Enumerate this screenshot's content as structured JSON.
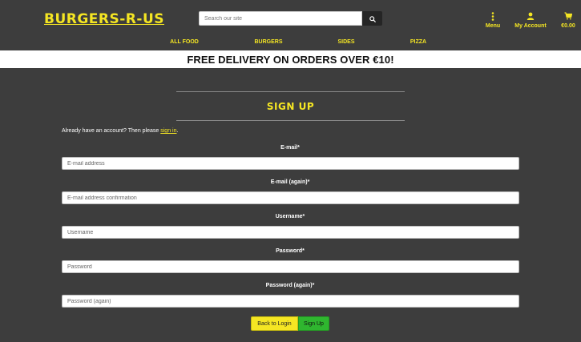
{
  "header": {
    "logo": "BURGERS-R-US",
    "search": {
      "placeholder": "Search our site",
      "value": ""
    },
    "links": {
      "menu": "Menu",
      "account": "My Account",
      "cart": "€0.00"
    },
    "nav": [
      "ALL FOOD",
      "BURGERS",
      "SIDES",
      "PIZZA"
    ]
  },
  "banner": "FREE DELIVERY ON ORDERS OVER €10!",
  "signup": {
    "title": "SIGN UP",
    "already_prefix": "Already have an account? Then please ",
    "already_link": "sign in",
    "already_suffix": ".",
    "fields": [
      {
        "label": "E-mail*",
        "placeholder": "E-mail address"
      },
      {
        "label": "E-mail (again)*",
        "placeholder": "E-mail address confirmation"
      },
      {
        "label": "Username*",
        "placeholder": "Username"
      },
      {
        "label": "Password*",
        "placeholder": "Password"
      },
      {
        "label": "Password (again)*",
        "placeholder": "Password (again)"
      }
    ],
    "back_button": "Back to Login",
    "submit_button": "Sign Up"
  },
  "colors": {
    "background": "#3d3d3d",
    "accent": "#f5e623",
    "banner_bg": "#ffffff",
    "signup_green": "#2fb62f"
  },
  "icons": [
    "search-icon",
    "ellipsis-vertical-icon",
    "user-icon",
    "shopping-cart-icon"
  ]
}
